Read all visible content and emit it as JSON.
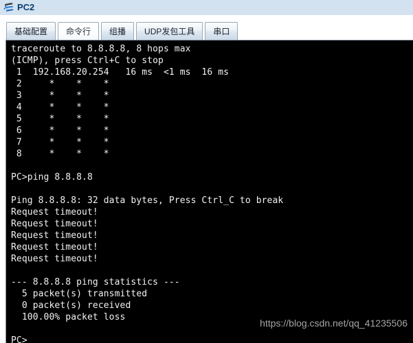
{
  "window": {
    "title": "PC2",
    "icon": "pc-host-icon"
  },
  "tabs": [
    {
      "label": "基础配置",
      "name": "tab-basic-config",
      "active": false
    },
    {
      "label": "命令行",
      "name": "tab-command-line",
      "active": true
    },
    {
      "label": "组播",
      "name": "tab-multicast",
      "active": false
    },
    {
      "label": "UDP发包工具",
      "name": "tab-udp-packet-tool",
      "active": false
    },
    {
      "label": "串口",
      "name": "tab-serial-port",
      "active": false
    }
  ],
  "terminal": {
    "lines": [
      "traceroute to 8.8.8.8, 8 hops max",
      "(ICMP), press Ctrl+C to stop",
      " 1  192.168.20.254   16 ms  <1 ms  16 ms",
      " 2     *    *    *",
      " 3     *    *    *",
      " 4     *    *    *",
      " 5     *    *    *",
      " 6     *    *    *",
      " 7     *    *    *",
      " 8     *    *    *",
      "",
      "PC>ping 8.8.8.8",
      "",
      "Ping 8.8.8.8: 32 data bytes, Press Ctrl_C to break",
      "Request timeout!",
      "Request timeout!",
      "Request timeout!",
      "Request timeout!",
      "Request timeout!",
      "",
      "--- 8.8.8.8 ping statistics ---",
      "  5 packet(s) transmitted",
      "  0 packet(s) received",
      "  100.00% packet loss",
      "",
      "PC>"
    ]
  },
  "watermark": {
    "text": "https://blog.csdn.net/qq_41235506"
  },
  "colors": {
    "terminal_background": "#000000",
    "terminal_text": "#f2f2f2",
    "title_text": "#0c3c6e",
    "window_chrome": "#d3e2f0"
  }
}
